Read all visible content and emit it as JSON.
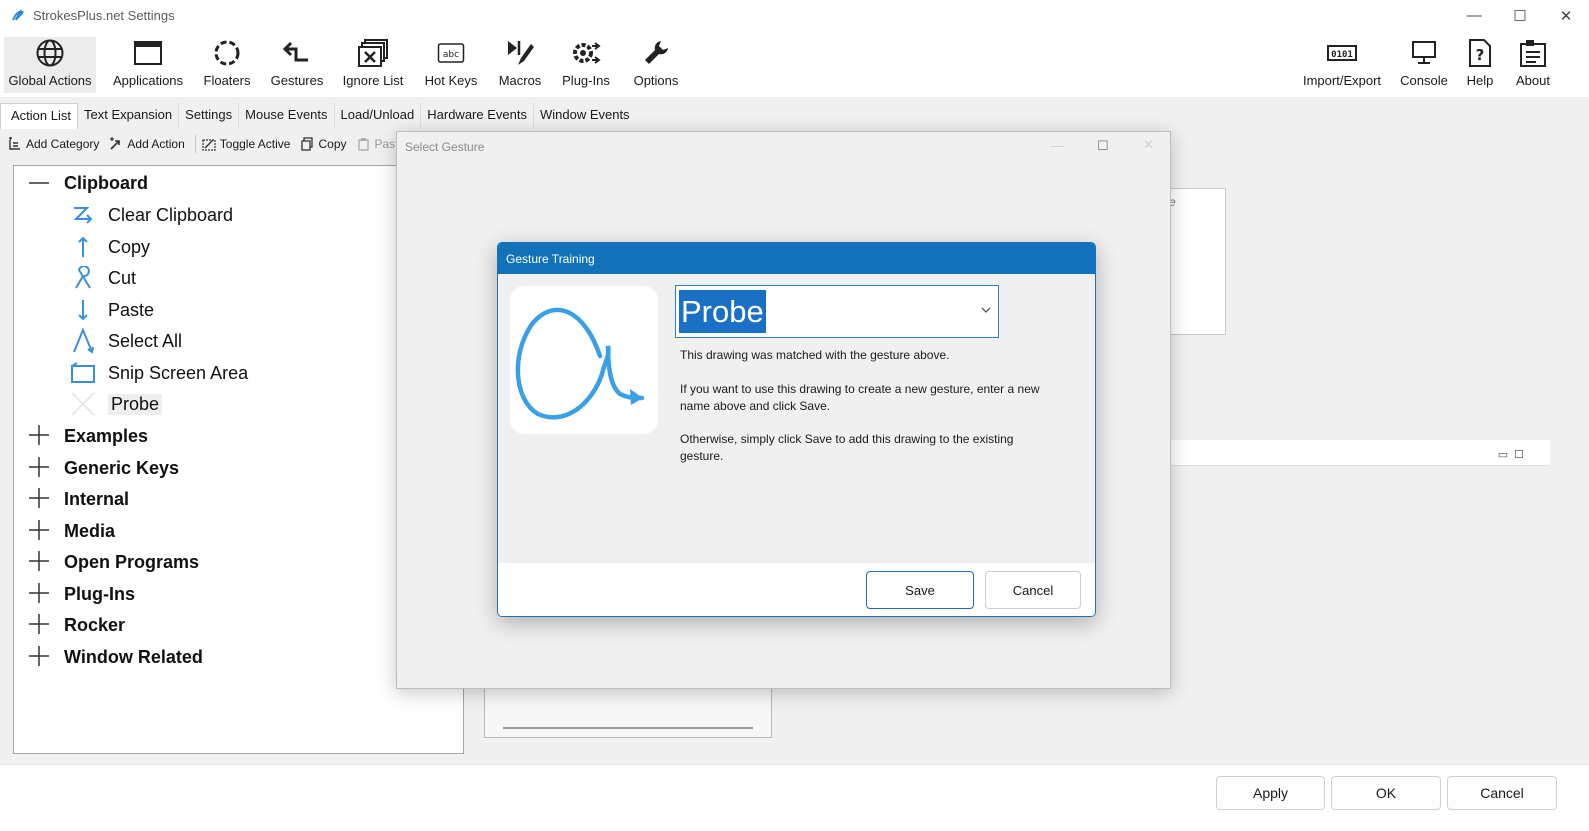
{
  "window": {
    "title": "StrokesPlus.net Settings",
    "min": "—",
    "max": "☐",
    "close": "✕"
  },
  "ribbon": {
    "left": [
      {
        "label": "Global Actions",
        "icon": "globe-icon"
      },
      {
        "label": "Applications",
        "icon": "window-icon"
      },
      {
        "label": "Floaters",
        "icon": "circle-dots-icon"
      },
      {
        "label": "Gestures",
        "icon": "gesture-arrow-icon"
      },
      {
        "label": "Ignore List",
        "icon": "ignore-windows-icon"
      },
      {
        "label": "Hot Keys",
        "icon": "keyboard-abc-icon"
      },
      {
        "label": "Macros",
        "icon": "macros-icon"
      },
      {
        "label": "Plug-Ins",
        "icon": "plugin-gear-icon"
      },
      {
        "label": "Options",
        "icon": "wrench-icon"
      }
    ],
    "right": [
      {
        "label": "Import/Export",
        "icon": "import-export-icon"
      },
      {
        "label": "Console",
        "icon": "monitor-icon"
      },
      {
        "label": "Help",
        "icon": "help-icon"
      },
      {
        "label": "About",
        "icon": "about-icon"
      }
    ]
  },
  "tabs": [
    "Action List",
    "Text Expansion",
    "Settings",
    "Mouse Events",
    "Load/Unload",
    "Hardware Events",
    "Window Events"
  ],
  "toolbar": {
    "add_category": "Add Category",
    "add_action": "Add Action",
    "toggle_active": "Toggle Active",
    "copy": "Copy",
    "paste": "Paste"
  },
  "tree": {
    "expanded_category": "Clipboard",
    "actions": [
      "Clear Clipboard",
      "Copy",
      "Cut",
      "Paste",
      "Select All",
      "Snip Screen Area",
      "Probe"
    ],
    "categories": [
      "Examples",
      "Generic Keys",
      "Internal",
      "Media",
      "Open Programs",
      "Plug-Ins",
      "Rocker",
      "Window Related"
    ]
  },
  "background": {
    "gesture_hint_fragment": "re"
  },
  "bottom": {
    "apply": "Apply",
    "ok": "OK",
    "cancel": "Cancel"
  },
  "select_gesture_dialog": {
    "title": "Select Gesture"
  },
  "gesture_training": {
    "title": "Gesture Training",
    "gesture_name": "Probe",
    "msg1": "This drawing was matched with the gesture above.",
    "msg2": "If you want to use this drawing to create a new gesture, enter a new name above and click Save.",
    "msg3": "Otherwise, simply click Save to add this drawing to the existing gesture.",
    "save": "Save",
    "cancel": "Cancel",
    "accent": "#1272b9",
    "stroke_color": "#3aa0e6"
  }
}
